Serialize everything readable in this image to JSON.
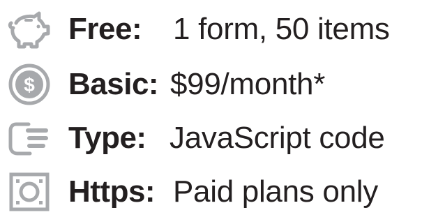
{
  "colors": {
    "icon": "#a7a9ac",
    "text": "#231f20"
  },
  "features": [
    {
      "icon": "piggy-bank-icon",
      "label": "Free:",
      "value": "1 form, 50 items"
    },
    {
      "icon": "dollar-coin-icon",
      "label": "Basic:",
      "value": "$99/month*"
    },
    {
      "icon": "hand-code-icon",
      "label": "Type:",
      "value": "JavaScript code"
    },
    {
      "icon": "secure-box-icon",
      "label": "Https:",
      "value": "Paid plans only"
    }
  ]
}
